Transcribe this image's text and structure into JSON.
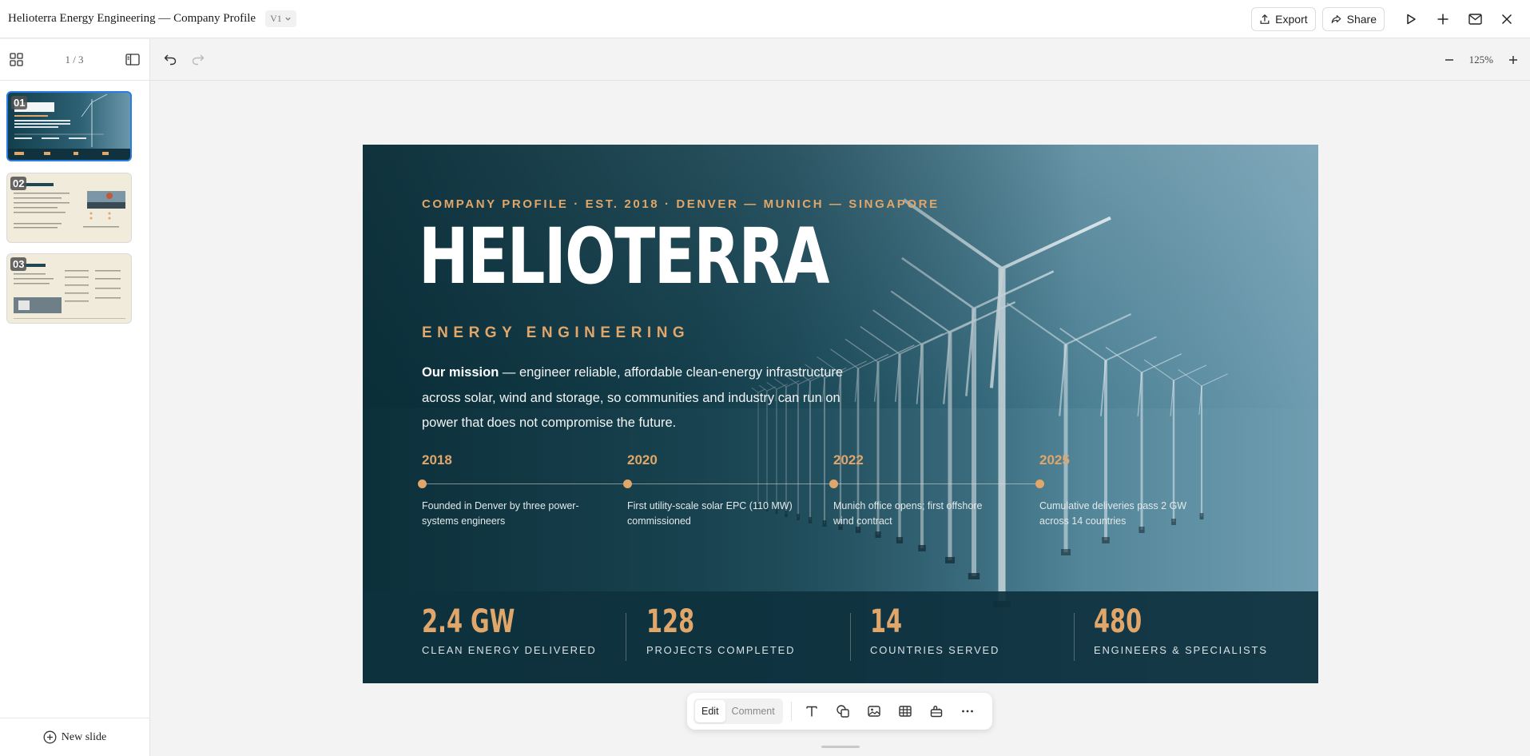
{
  "window": {
    "title": "Helioterra Energy Engineering — Company Profile",
    "version": "V1",
    "export_label": "Export",
    "share_label": "Share"
  },
  "sidebar": {
    "counter": "1 / 3",
    "thumbnails": [
      {
        "number": "01",
        "active": true
      },
      {
        "number": "02",
        "active": false
      },
      {
        "number": "03",
        "active": false
      }
    ],
    "new_slide_label": "New slide"
  },
  "canvas": {
    "zoom": "125%"
  },
  "slide": {
    "eyebrow": "COMPANY PROFILE · EST. 2018 · DENVER — MUNICH — SINGAPORE",
    "brand": "HELIOTERRA",
    "subbrand": "ENERGY ENGINEERING",
    "mission_lead": "Our mission",
    "mission_text": " — engineer reliable, affordable clean-energy infrastructure across solar, wind and storage, so communities and industry can run on power that does not compromise the future.",
    "timeline": [
      {
        "year": "2018",
        "desc": "Founded in Denver by three power-systems engineers"
      },
      {
        "year": "2020",
        "desc": "First utility-scale solar EPC (110 MW) commissioned"
      },
      {
        "year": "2022",
        "desc": "Munich office opens; first offshore wind contract"
      },
      {
        "year": "2025",
        "desc": "Cumulative deliveries pass 2 GW across 14 countries"
      }
    ],
    "stats": [
      {
        "value": "2.4 GW",
        "label": "CLEAN ENERGY DELIVERED"
      },
      {
        "value": "128",
        "label": "PROJECTS COMPLETED"
      },
      {
        "value": "14",
        "label": "COUNTRIES SERVED"
      },
      {
        "value": "480",
        "label": "ENGINEERS & SPECIALISTS"
      }
    ]
  },
  "toolbar": {
    "edit_label": "Edit",
    "comment_label": "Comment",
    "tools": [
      "text-icon",
      "shapes-icon",
      "image-icon",
      "table-icon",
      "plugin-icon",
      "more-icon"
    ]
  },
  "colors": {
    "accent": "#e0a66a",
    "slide_bg": "#0f3a47",
    "selection": "#2a7de1"
  }
}
